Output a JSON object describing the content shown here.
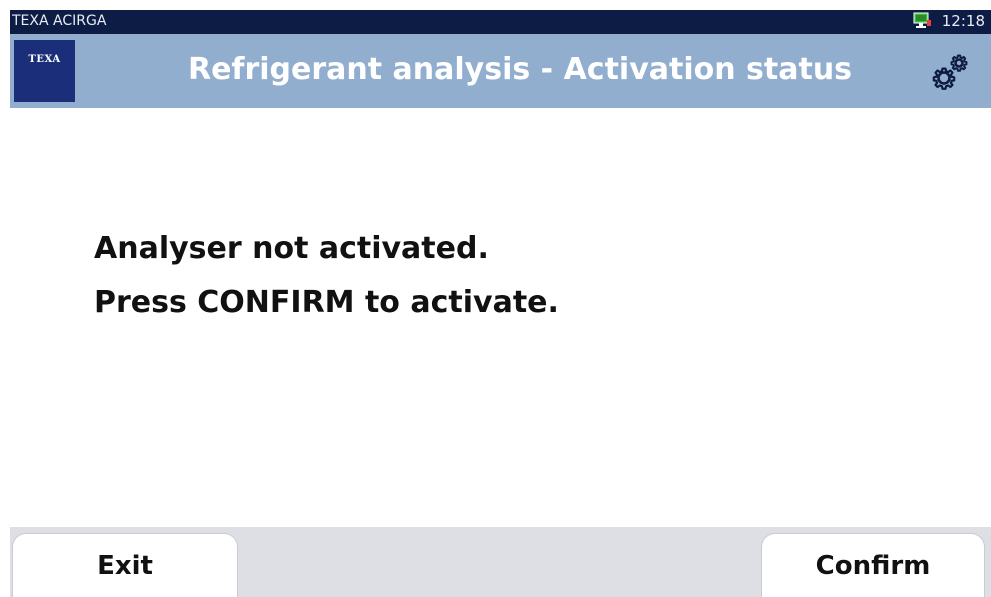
{
  "status_bar": {
    "app_name": "TEXA ACIRGA",
    "time": "12:18",
    "network_icon": "monitor-network-icon"
  },
  "header": {
    "logo_text": "TEXA",
    "title": "Refrigerant analysis - Activation status",
    "settings_icon": "gears-icon"
  },
  "message": {
    "line1": "Analyser not activated.",
    "line2": "Press CONFIRM to activate."
  },
  "footer": {
    "exit_label": "Exit",
    "confirm_label": "Confirm"
  },
  "colors": {
    "status_bar_bg": "#0d1c44",
    "title_bar_bg": "#92aecf",
    "logo_bg": "#1a2e7a",
    "footer_bg": "#dddfe4",
    "network_icon_green": "#3fbf3f"
  }
}
